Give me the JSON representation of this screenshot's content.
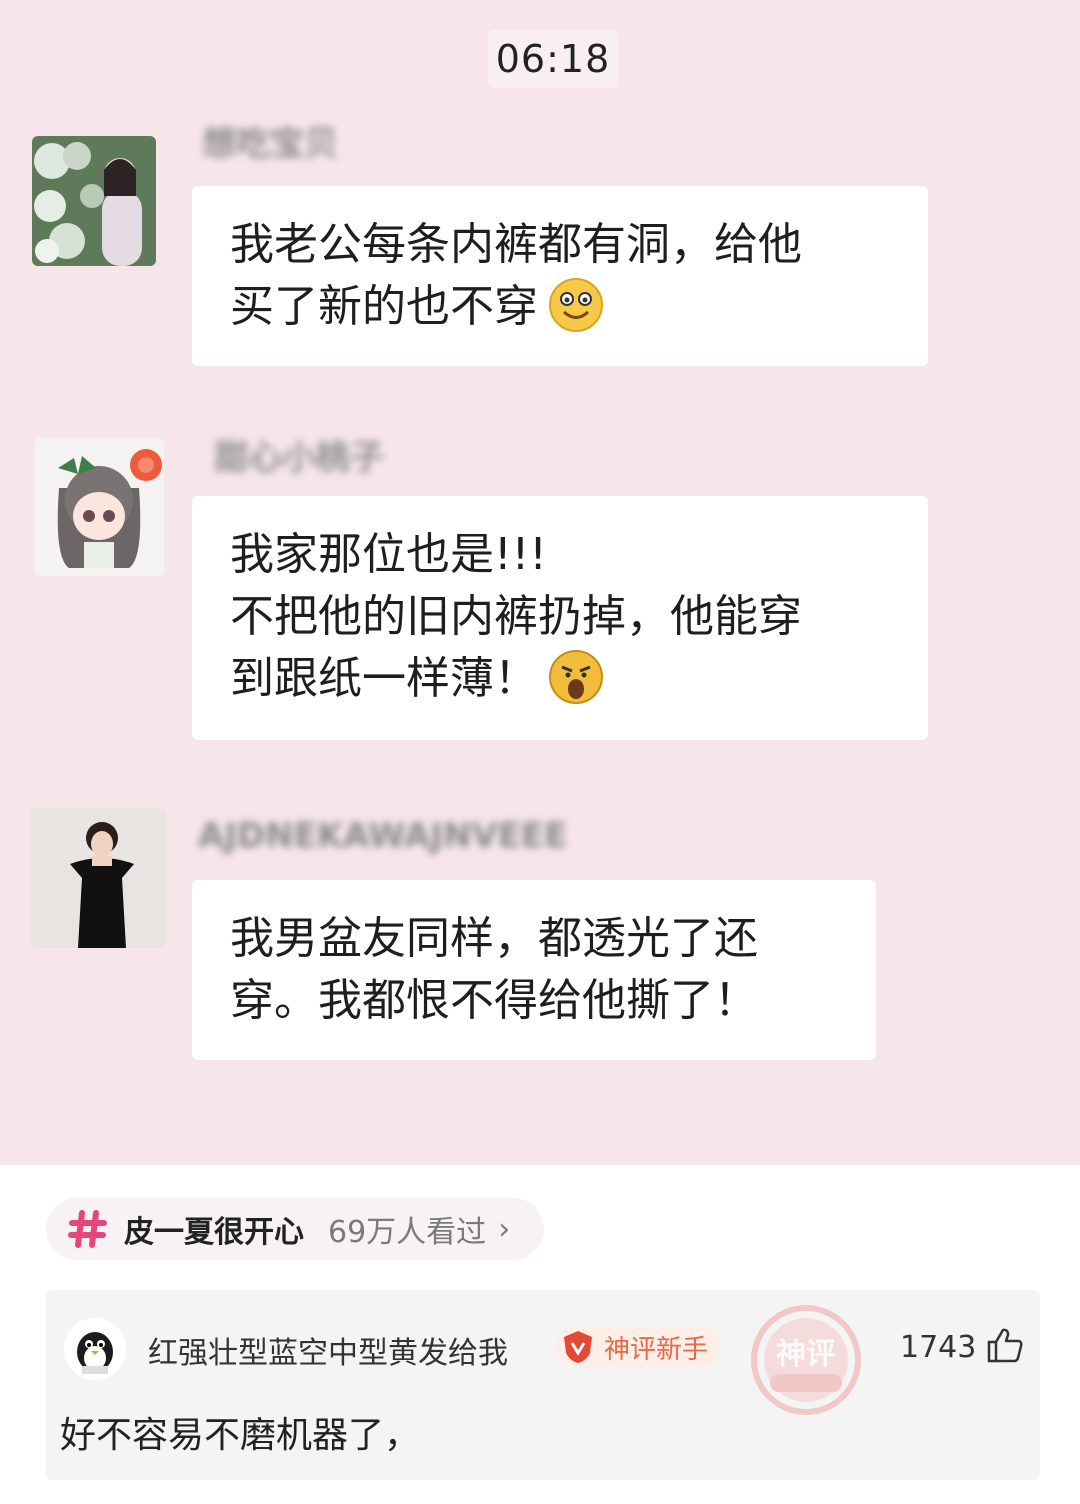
{
  "chat": {
    "time": "06:18",
    "messages": [
      {
        "sender": "想吃宝贝",
        "lines": [
          "我老公每条内裤都有洞，给他",
          "买了新的也不穿"
        ],
        "emoji": "smile-emoji-icon"
      },
      {
        "sender": "甜心小桃子",
        "lines": [
          "我家那位也是!!!",
          "不把他的旧内裤扔掉，他能穿",
          "到跟纸一样薄！"
        ],
        "emoji": "shocked-emoji-icon"
      },
      {
        "sender": "AJDNEKAWAJNVEEE",
        "lines": [
          "我男盆友同样，都透光了还",
          "穿。我都恨不得给他撕了！"
        ],
        "emoji": ""
      }
    ]
  },
  "topic": {
    "icon": "hashtag-icon",
    "title": "皮一夏很开心",
    "views": "69万人看过",
    "arrow": "›"
  },
  "comment": {
    "username": "红强壮型蓝空中型黄发给我",
    "badge_label": "神评新手",
    "stamp_text": "神评",
    "likes": "1743",
    "text": "好不容易不磨机器了，"
  },
  "colors": {
    "chat_background": "#f6e6ea",
    "bubble": "#ffffff",
    "badge_text": "#e86a45",
    "hashtag": "#e8457a"
  }
}
